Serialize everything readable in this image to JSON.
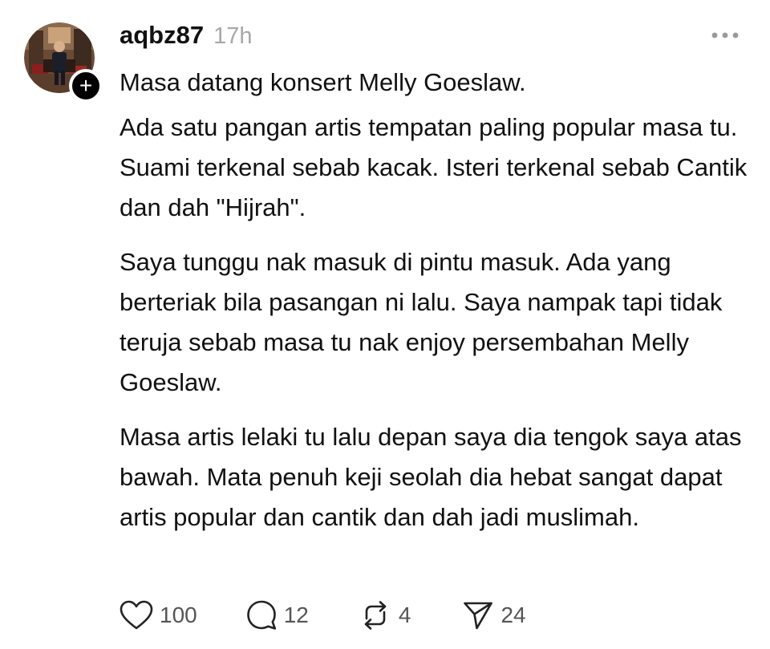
{
  "post": {
    "username": "aqbz87",
    "timestamp": "17h",
    "paragraphs": [
      "Masa datang konsert Melly Goeslaw.",
      "Ada satu pangan artis tempatan paling popular masa tu. Suami terkenal sebab kacak. Isteri terkenal sebab Cantik dan dah \"Hijrah\".",
      "Saya tunggu nak masuk di pintu masuk. Ada yang berteriak bila pasangan ni lalu. Saya nampak tapi tidak teruja sebab masa tu nak enjoy persembahan Melly Goeslaw.",
      "Masa artis lelaki tu lalu depan saya dia tengok saya atas bawah. Mata penuh keji seolah dia hebat sangat dapat artis popular dan cantik dan dah jadi muslimah."
    ]
  },
  "avatar": {
    "follow_badge": "+"
  },
  "icons": {
    "more": "more-horizontal-icon",
    "like": "heart-icon",
    "reply": "comment-icon",
    "repost": "repost-icon",
    "share": "send-icon"
  },
  "actions": {
    "likes": "100",
    "replies": "12",
    "reposts": "4",
    "shares": "24"
  },
  "colors": {
    "text": "#111111",
    "muted": "#a7a7a7",
    "count": "#555555",
    "badge": "#000000"
  }
}
